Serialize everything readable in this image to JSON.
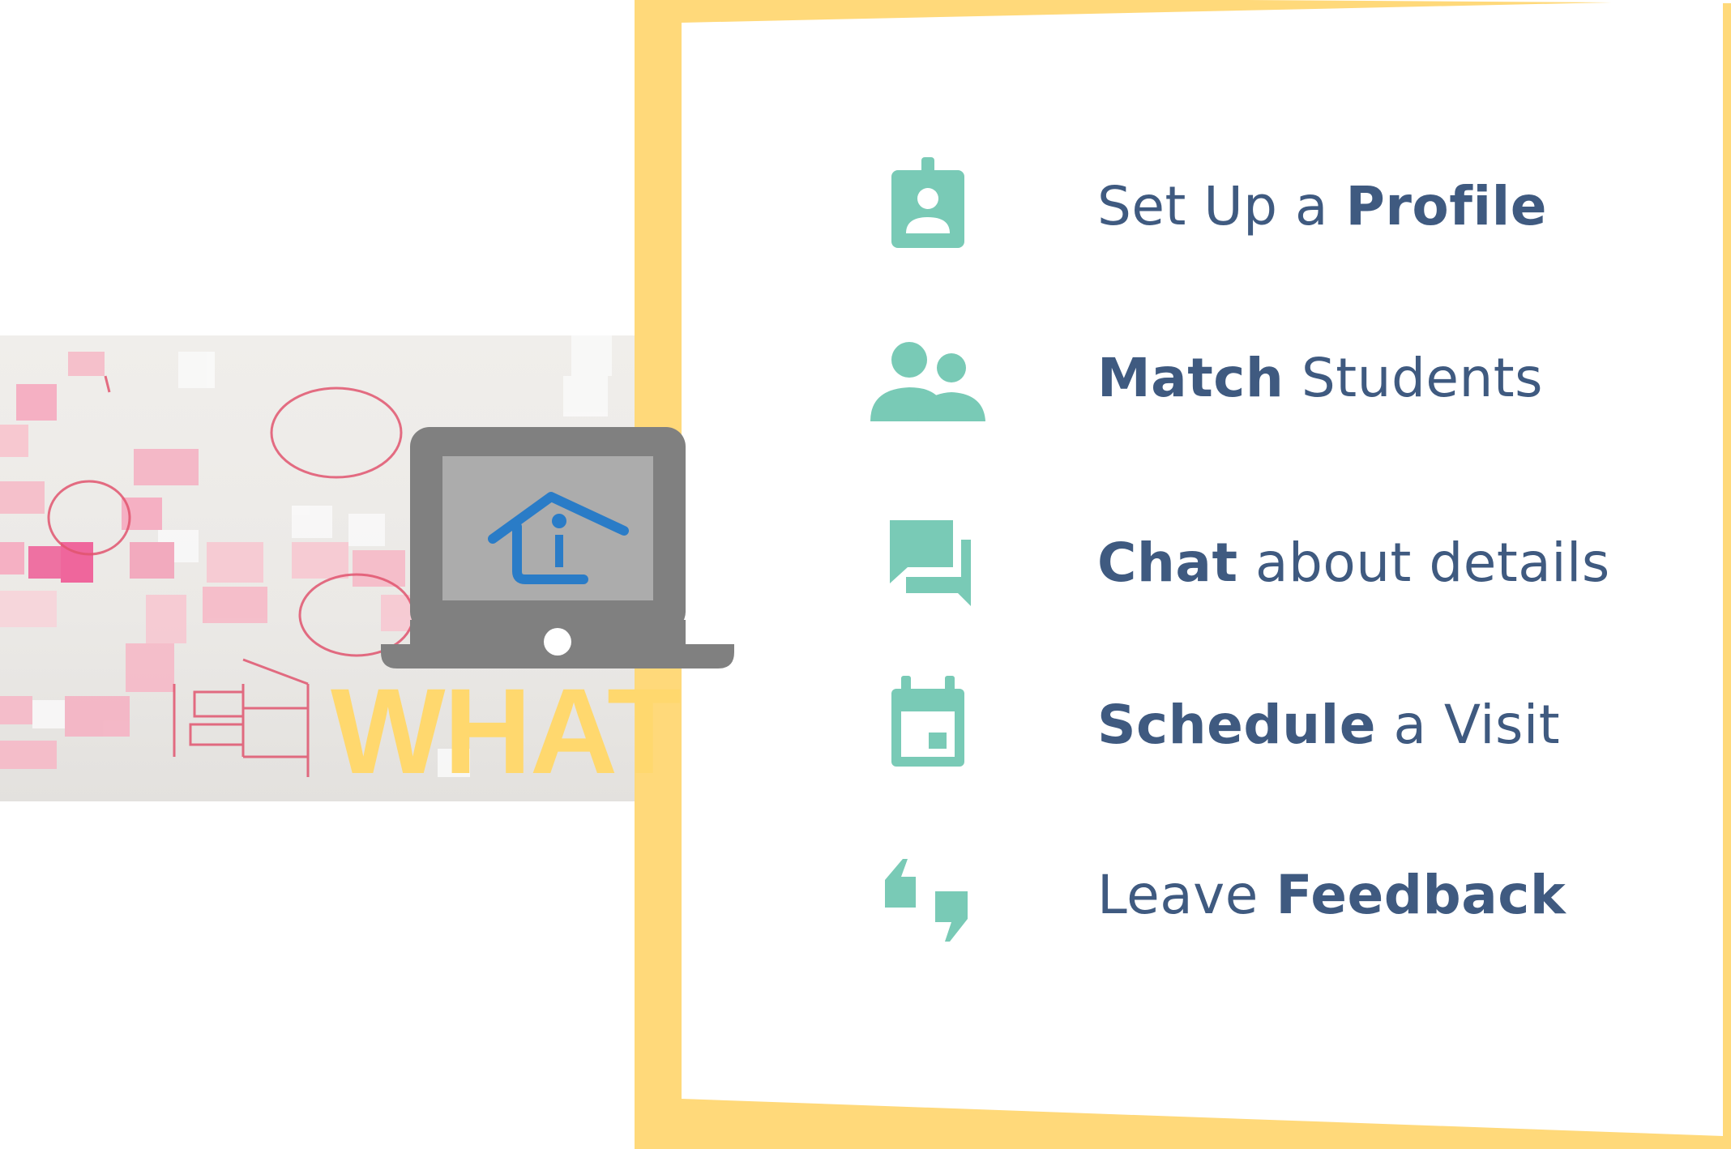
{
  "colors": {
    "accent_yellow": "#ffd97a",
    "icon_teal": "#79cab6",
    "text_navy": "#3f5a80",
    "laptop_gray": "#808080",
    "logo_blue": "#2a7cc7"
  },
  "hero": {
    "word": "WHAT"
  },
  "features": [
    {
      "icon": "profile-badge-icon",
      "light_before": "Set Up a ",
      "bold": "Profile",
      "light_after": ""
    },
    {
      "icon": "people-icon",
      "light_before": "",
      "bold": "Match",
      "light_after": " Students"
    },
    {
      "icon": "chat-bubbles-icon",
      "light_before": "",
      "bold": "Chat",
      "light_after": " about details"
    },
    {
      "icon": "calendar-icon",
      "light_before": "",
      "bold": "Schedule",
      "light_after": " a Visit"
    },
    {
      "icon": "feedback-quote-icon",
      "light_before": "Leave ",
      "bold": "Feedback",
      "light_after": ""
    }
  ]
}
